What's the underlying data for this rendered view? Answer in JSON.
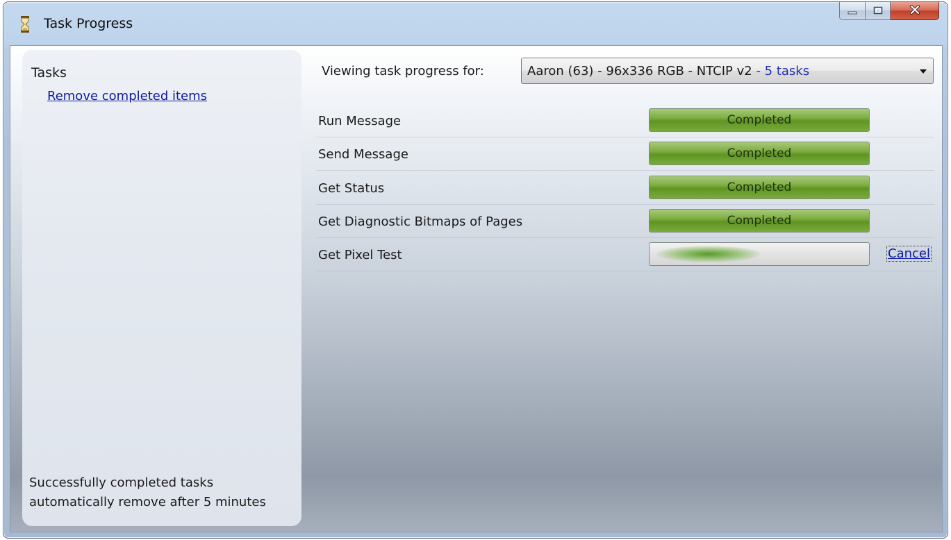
{
  "window": {
    "title": "Task Progress"
  },
  "sidebar": {
    "heading": "Tasks",
    "remove_link": "Remove completed items",
    "footer_line1": "Successfully completed tasks",
    "footer_line2": "automatically remove after 5 minutes"
  },
  "header": {
    "viewing_label": "Viewing task progress for:",
    "selected_device": "Aaron (63) - 96x336 RGB - NTCIP v2",
    "selected_count": " - 5 tasks"
  },
  "tasks": [
    {
      "name": "Run Message",
      "status": "Completed",
      "progress": 1.0
    },
    {
      "name": "Send Message",
      "status": "Completed",
      "progress": 1.0
    },
    {
      "name": "Get Status",
      "status": "Completed",
      "progress": 1.0
    },
    {
      "name": "Get Diagnostic Bitmaps of Pages",
      "status": "Completed",
      "progress": 1.0
    },
    {
      "name": "Get Pixel Test",
      "status": "",
      "progress": null,
      "indeterminate": true,
      "cancel_label": "Cancel"
    }
  ],
  "colors": {
    "progress_green": "#6ea131",
    "link_blue": "#0c1aa6",
    "close_red": "#c0412b"
  },
  "icons": {
    "app": "hourglass-icon",
    "minimize": "minimize-icon",
    "maximize": "maximize-icon",
    "close": "close-icon"
  }
}
